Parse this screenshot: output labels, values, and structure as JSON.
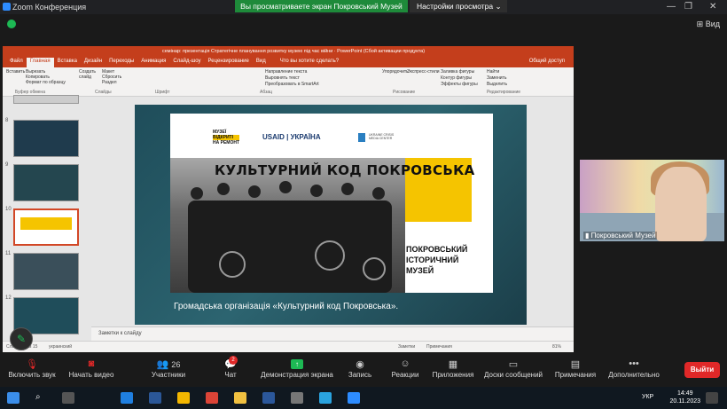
{
  "zoom": {
    "window_title": "Zoom Конференция",
    "share_banner": "Вы просматриваете экран Покровський Музей",
    "view_settings": "Настройки просмотра",
    "view_button": "Вид"
  },
  "ppt": {
    "doc_title": "семінар: презентація Стратегічне планування розвитку музею під час війни · PowerPoint (Сбой активации продукта)",
    "tabs": [
      "Файл",
      "Главная",
      "Вставка",
      "Дизайн",
      "Переходы",
      "Анимация",
      "Слайд-шоу",
      "Рецензирование",
      "Вид"
    ],
    "tell_me": "Что вы хотите сделать?",
    "share": "Общий доступ",
    "ribbon": {
      "paste": "Вставить",
      "cut": "Вырезать",
      "copy": "Копировать",
      "format_painter": "Формат по образцу",
      "clipboard": "Буфер обмена",
      "new_slide": "Создать слайд",
      "layout": "Макет",
      "reset": "Сбросить",
      "section": "Раздел",
      "slides": "Слайды",
      "font": "Шрифт",
      "paragraph": "Абзац",
      "text_direction": "Направление текста",
      "align_text": "Выровнять текст",
      "smartart": "Преобразовать в SmartArt",
      "drawing": "Рисование",
      "arrange": "Упорядочить",
      "quick_styles": "Экспресс-стили",
      "shape_fill": "Заливка фигуры",
      "shape_outline": "Контур фигуры",
      "shape_effects": "Эффекты фигуры",
      "find": "Найти",
      "replace": "Заменить",
      "select": "Выделить",
      "editing": "Редактирование"
    },
    "thumb_numbers": [
      "8",
      "9",
      "10",
      "11",
      "12"
    ],
    "notes_placeholder": "Заметки к слайду",
    "status": {
      "slide_info": "Слайд 10 из 15",
      "lang": "украинский",
      "notes": "Заметки",
      "comments": "Примечания",
      "zoom": "81%"
    }
  },
  "slide": {
    "logo1_line1": "МУЗЕЇ",
    "logo1_line2": "ВІДКРИТІ",
    "logo1_line3": "НА РЕМОНТ",
    "logo2": "USAID | УКРАЇНА",
    "logo3": "UKRAINE CRISIS MEDIA CENTER",
    "title": "КУЛЬТУРНИЙ КОД ПОКРОВСЬКА",
    "museum_line1": "ПОКРОВСЬКИЙ",
    "museum_line2": "ІСТОРИЧНИЙ",
    "museum_line3": "МУЗЕЙ",
    "caption": "Громадська організація «Культурний код Покровська»."
  },
  "video": {
    "participant": "Покровський Музей"
  },
  "toolbar": {
    "audio": "Включить звук",
    "video": "Начать видео",
    "participants": "Участники",
    "participants_count": "26",
    "chat": "Чат",
    "chat_badge": "2",
    "share_screen": "Демонстрация экрана",
    "record": "Запись",
    "reactions": "Реакции",
    "apps": "Приложения",
    "whiteboards": "Доски сообщений",
    "notes": "Примечания",
    "more": "Дополнительно",
    "leave": "Выйти"
  },
  "taskbar": {
    "lang": "УКР",
    "time": "14:49",
    "date": "20.11.2023"
  },
  "colors": {
    "ppt_red": "#c43e1c",
    "zoom_green": "#1e8a3a",
    "slide_yellow": "#f5c400",
    "leave_red": "#e02828"
  }
}
